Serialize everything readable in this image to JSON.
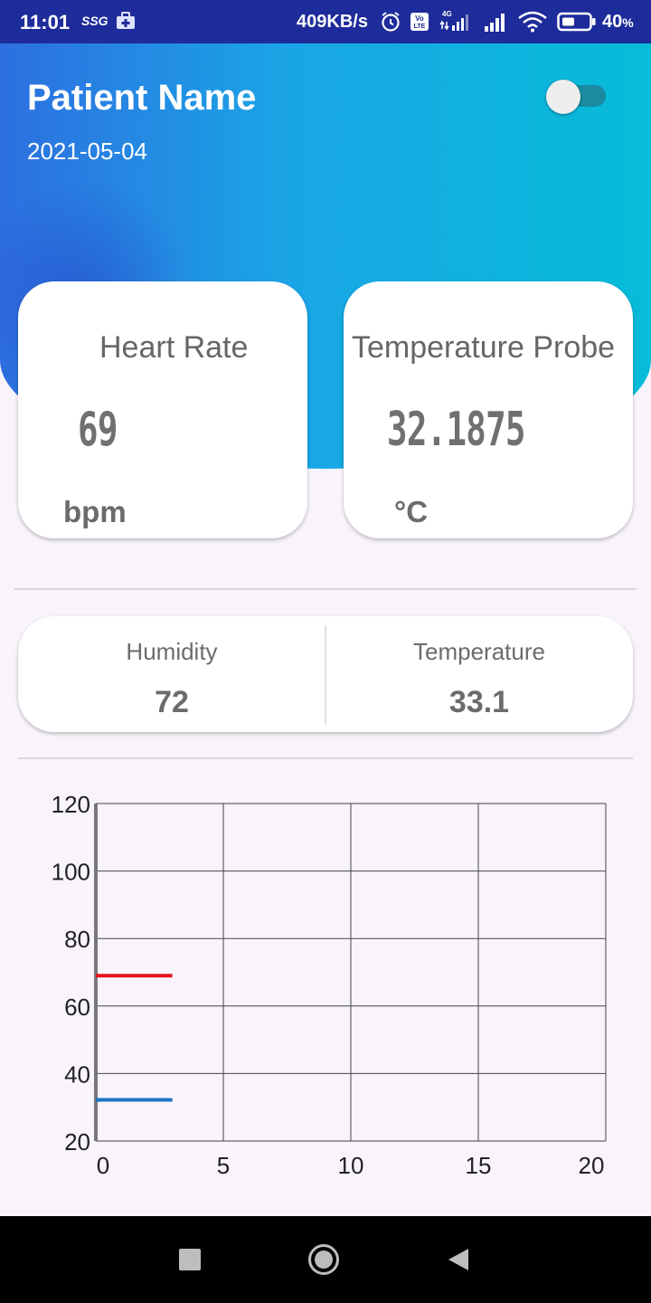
{
  "status_bar": {
    "time": "11:01",
    "carrier_tag": "SSG",
    "net_speed": "409KB/s",
    "battery": "40",
    "battery_unit": "%"
  },
  "header": {
    "patient_name": "Patient Name",
    "date": "2021-05-04",
    "toggle_on": true
  },
  "cards": {
    "heart_rate": {
      "title": "Heart Rate",
      "value": "69",
      "unit": "bpm"
    },
    "temperature_probe": {
      "title": "Temperature Probe",
      "value": "32.1875",
      "unit": "°C"
    }
  },
  "environment": {
    "humidity_label": "Humidity",
    "humidity_value": "72",
    "temperature_label": "Temperature",
    "temperature_value": "33.1"
  },
  "chart_data": {
    "type": "line",
    "xlim": [
      0,
      20
    ],
    "ylim": [
      20,
      120
    ],
    "x_ticks": [
      "0",
      "5",
      "10",
      "15",
      "20"
    ],
    "y_ticks": [
      "20",
      "40",
      "60",
      "80",
      "100",
      "120"
    ],
    "grid": true,
    "series": [
      {
        "color": "#e8141e",
        "x": [
          0,
          3
        ],
        "y": [
          69,
          69
        ]
      },
      {
        "color": "#1a73c6",
        "x": [
          0,
          3
        ],
        "y": [
          32.1875,
          32.1875
        ]
      }
    ]
  },
  "colors": {
    "status_bar": "#1e2b9a",
    "header_gradient_start": "#2d6fe0",
    "header_gradient_end": "#06bcd8",
    "page_background": "#f9f4fc"
  },
  "nav": {
    "recent_icon": "square-icon",
    "home_icon": "circle-icon",
    "back_icon": "triangle-back-icon"
  }
}
